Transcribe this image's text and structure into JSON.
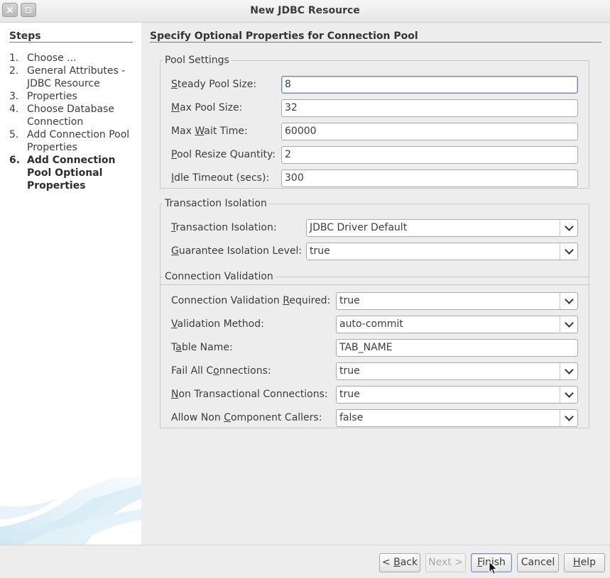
{
  "window": {
    "title": "New JDBC Resource",
    "close_icon": "close-icon",
    "maximize_icon": "maximize-icon"
  },
  "steps": {
    "heading": "Steps",
    "items": [
      {
        "num": "1.",
        "label": "Choose ..."
      },
      {
        "num": "2.",
        "label": "General Attributes - JDBC Resource"
      },
      {
        "num": "3.",
        "label": "Properties"
      },
      {
        "num": "4.",
        "label": "Choose Database Connection"
      },
      {
        "num": "5.",
        "label": "Add Connection Pool Properties"
      },
      {
        "num": "6.",
        "label": "Add Connection Pool Optional Properties"
      }
    ],
    "current_index": 5
  },
  "main": {
    "title": "Specify Optional Properties for Connection Pool"
  },
  "pool_settings": {
    "legend": "Pool Settings",
    "steady_pool_size": {
      "label_key": "S",
      "label_rest": "teady Pool Size:",
      "value": "8"
    },
    "max_pool_size": {
      "label_key": "M",
      "label_rest": "ax Pool Size:",
      "value": "32"
    },
    "max_wait_time": {
      "label_pre": "Max ",
      "label_key": "W",
      "label_rest": "ait Time:",
      "value": "60000"
    },
    "pool_resize_quantity": {
      "label_key": "P",
      "label_rest": "ool Resize Quantity:",
      "value": "2"
    },
    "idle_timeout": {
      "label_key": "I",
      "label_rest": "dle Timeout (secs):",
      "value": "300"
    }
  },
  "transaction_isolation": {
    "legend": "Transaction Isolation",
    "isolation": {
      "label_key": "T",
      "label_rest": "ransaction Isolation:",
      "value": "JDBC Driver Default"
    },
    "guarantee": {
      "label_key": "G",
      "label_rest": "uarantee Isolation Level:",
      "value": "true"
    }
  },
  "connection_validation": {
    "legend": "Connection Validation",
    "required": {
      "label_pre": "Connection Validation ",
      "label_key": "R",
      "label_rest": "equired:",
      "value": "true"
    },
    "method": {
      "label_key": "V",
      "label_rest": "alidation Method:",
      "value": "auto-commit"
    },
    "table_name": {
      "label_pre": "T",
      "label_key": "a",
      "label_rest": "ble Name:",
      "value": "TAB_NAME"
    },
    "fail_all": {
      "label_pre": "Fail All C",
      "label_key": "o",
      "label_rest": "nnections:",
      "value": "true"
    },
    "non_transactional": {
      "label_key": "N",
      "label_rest": "on Transactional Connections:",
      "value": "true"
    },
    "allow_non_component": {
      "label_pre": "Allow Non ",
      "label_key": "C",
      "label_rest": "omponent Callers:",
      "value": "false"
    }
  },
  "buttons": {
    "back": {
      "pre": "< ",
      "key": "B",
      "rest": "ack"
    },
    "next": "Next >",
    "finish": {
      "key": "F",
      "rest": "inish"
    },
    "cancel": "Cancel",
    "help": {
      "key": "H",
      "rest": "elp"
    }
  }
}
